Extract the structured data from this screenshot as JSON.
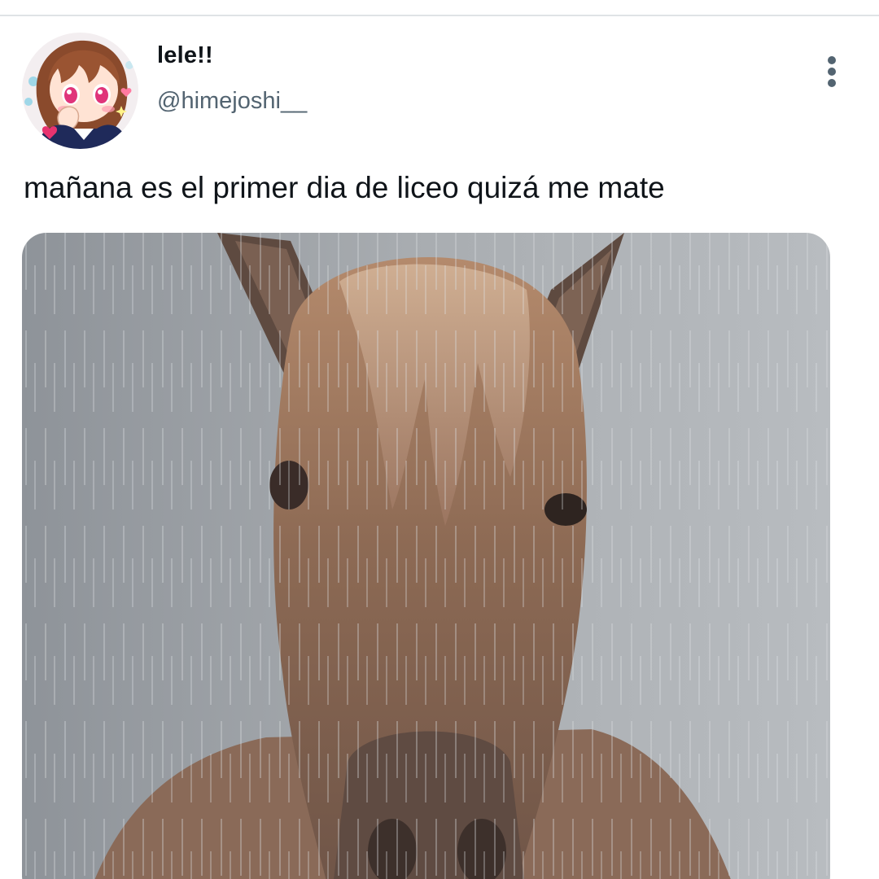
{
  "tweet": {
    "author": {
      "display_name": "lele!!",
      "handle": "@himejoshi__",
      "avatar_icon": "anime-girl-avatar"
    },
    "text": "mañana es el primer dia de liceo quizá me mate",
    "more_icon": "vertical-ellipsis-icon",
    "media": {
      "kind": "photo",
      "subject": "horse-in-rain-photo"
    }
  },
  "colors": {
    "text_primary": "#0f1419",
    "text_secondary": "#536471",
    "divider": "#dfe3e6",
    "icon": "#536471"
  }
}
